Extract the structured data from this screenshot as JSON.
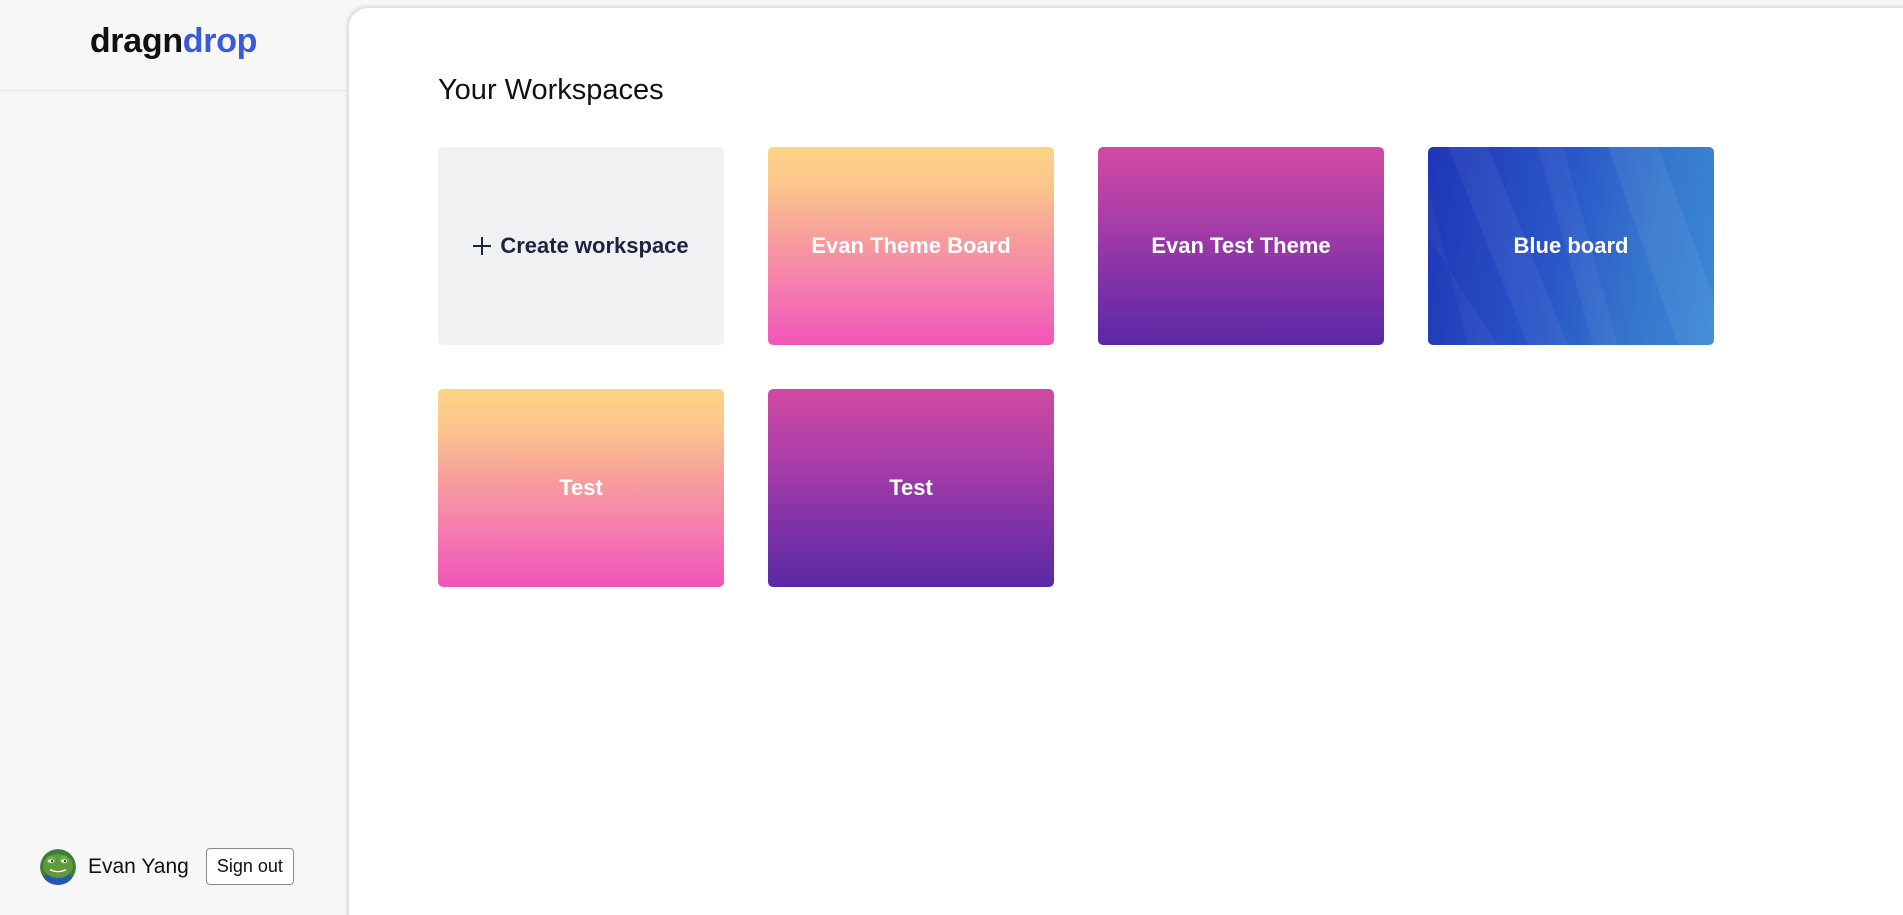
{
  "brand": {
    "part1": "dragn",
    "part2": "drop",
    "accent_color": "#3a5bd9"
  },
  "user": {
    "name": "Evan Yang",
    "avatar_icon": "frog-avatar-icon",
    "sign_out_label": "Sign out"
  },
  "page": {
    "title": "Your Workspaces"
  },
  "create_tile": {
    "icon": "plus-icon",
    "label": "Create workspace"
  },
  "workspaces": [
    {
      "label": "Evan Theme Board",
      "theme": "sunset"
    },
    {
      "label": "Evan Test Theme",
      "theme": "purple"
    },
    {
      "label": "Blue board",
      "theme": "blue"
    },
    {
      "label": "Test",
      "theme": "sunset"
    },
    {
      "label": "Test",
      "theme": "purple"
    }
  ]
}
